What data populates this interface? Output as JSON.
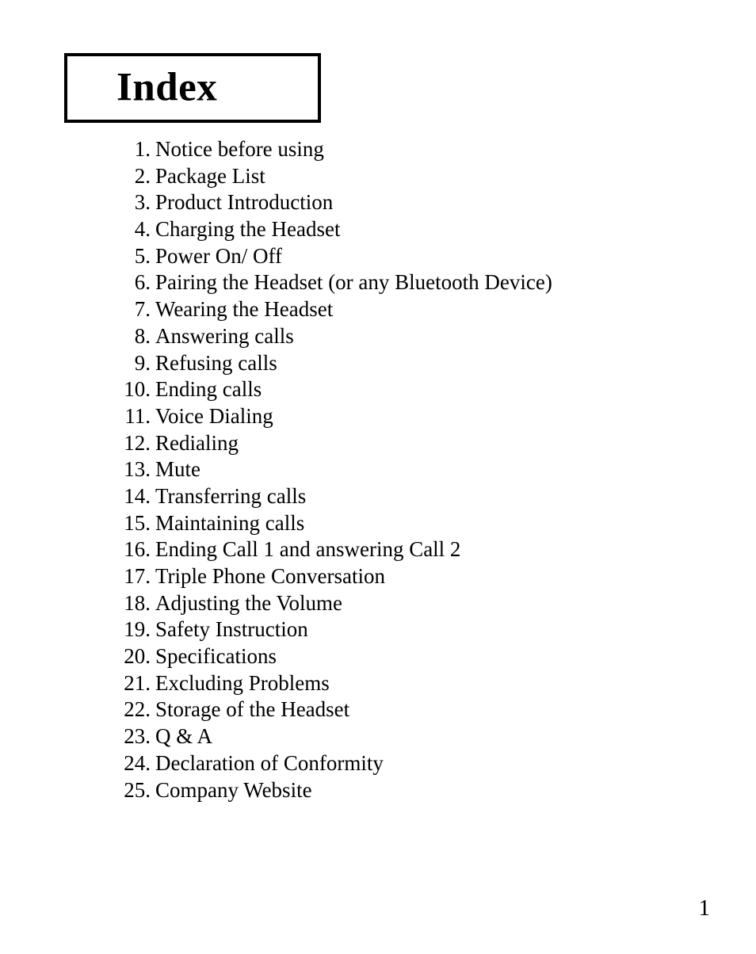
{
  "page": {
    "background_color": "#ffffff",
    "text_color": "#000000"
  },
  "title": {
    "text": "Index",
    "border_color": "#000000"
  },
  "index": {
    "items": [
      {
        "number": "1.",
        "label": "Notice before using"
      },
      {
        "number": "2.",
        "label": "Package List"
      },
      {
        "number": "3.",
        "label": "Product Introduction"
      },
      {
        "number": "4.",
        "label": "Charging the Headset"
      },
      {
        "number": "5.",
        "label": "Power On/ Off"
      },
      {
        "number": "6.",
        "label": "Pairing the Headset (or any Bluetooth Device)"
      },
      {
        "number": "7.",
        "label": "Wearing the Headset"
      },
      {
        "number": "8.",
        "label": "Answering calls"
      },
      {
        "number": "9.",
        "label": "Refusing calls"
      },
      {
        "number": "10.",
        "label": "Ending calls"
      },
      {
        "number": "11.",
        "label": "Voice Dialing"
      },
      {
        "number": "12.",
        "label": "Redialing"
      },
      {
        "number": "13.",
        "label": "Mute"
      },
      {
        "number": "14.",
        "label": "Transferring calls"
      },
      {
        "number": "15.",
        "label": "Maintaining calls"
      },
      {
        "number": "16.",
        "label": "Ending Call 1 and answering Call 2"
      },
      {
        "number": "17.",
        "label": "Triple Phone Conversation"
      },
      {
        "number": "18.",
        "label": "Adjusting the Volume"
      },
      {
        "number": "19.",
        "label": "Safety Instruction"
      },
      {
        "number": "20.",
        "label": "Specifications"
      },
      {
        "number": "21.",
        "label": "Excluding Problems"
      },
      {
        "number": "22.",
        "label": "Storage of the Headset"
      },
      {
        "number": "23.",
        "label": "Q & A"
      },
      {
        "number": "24.",
        "label": "Declaration of Conformity"
      },
      {
        "number": "25.",
        "label": "Company Website"
      }
    ]
  },
  "footer": {
    "page_number": "1"
  }
}
